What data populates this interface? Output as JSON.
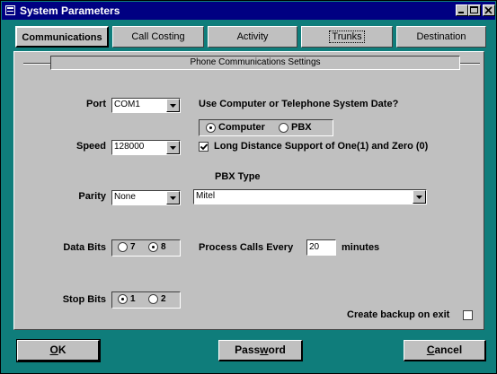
{
  "window": {
    "title": "System Parameters"
  },
  "tabs": [
    {
      "label": "Communications"
    },
    {
      "label": "Call Costing"
    },
    {
      "label": "Activity"
    },
    {
      "label": "Trunks"
    },
    {
      "label": "Destination"
    }
  ],
  "group": {
    "title": "Phone Communications Settings"
  },
  "port": {
    "label": "Port",
    "value": "COM1"
  },
  "speed": {
    "label": "Speed",
    "value": "128000"
  },
  "parity": {
    "label": "Parity",
    "value": "None"
  },
  "date_source": {
    "question": "Use Computer or Telephone System Date?",
    "options": [
      "Computer",
      "PBX"
    ],
    "selected": "Computer"
  },
  "long_distance": {
    "label": "Long Distance Support of One(1) and Zero (0)",
    "checked": true
  },
  "pbx_type": {
    "label": "PBX Type",
    "value": "Mitel"
  },
  "data_bits": {
    "label": "Data Bits",
    "options": [
      "7",
      "8"
    ],
    "selected": "8"
  },
  "stop_bits": {
    "label": "Stop Bits",
    "options": [
      "1",
      "2"
    ],
    "selected": "1"
  },
  "process_calls": {
    "prefix": "Process Calls Every",
    "value": "20",
    "suffix": "minutes"
  },
  "backup": {
    "label": "Create backup on exit",
    "checked": false
  },
  "buttons": {
    "ok": {
      "pre": "",
      "mnemonic": "O",
      "post": "K"
    },
    "password": {
      "pre": "Pass",
      "mnemonic": "w",
      "post": "ord"
    },
    "cancel": {
      "pre": "",
      "mnemonic": "C",
      "post": "ancel"
    }
  },
  "colors": {
    "titlebar": "#000082",
    "background": "#0f7d7b",
    "face": "#c0c0c0"
  },
  "icons": [
    "app-icon",
    "minimize-icon",
    "maximize-icon",
    "close-icon",
    "dropdown-arrow-icon",
    "checkmark-icon"
  ]
}
